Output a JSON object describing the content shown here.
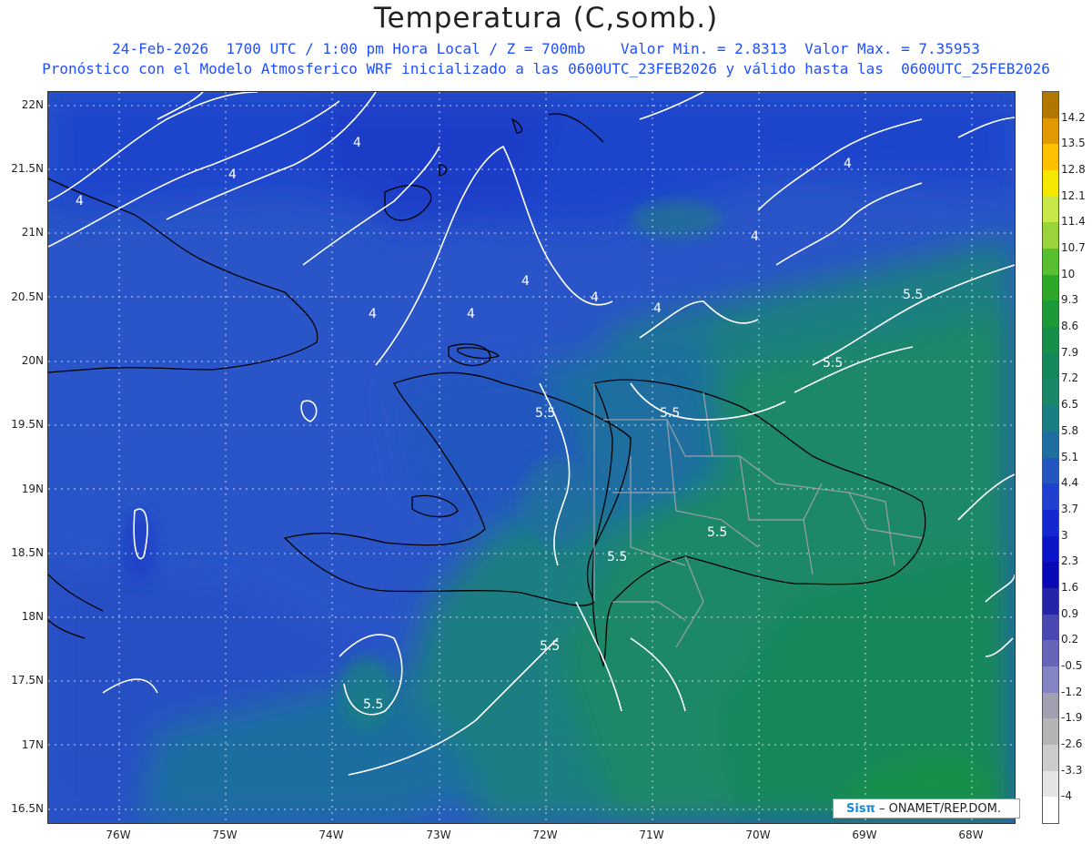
{
  "header": {
    "title": "Temperatura (C,somb.)",
    "line1": "24-Feb-2026  1700 UTC / 1:00 pm Hora Local / Z = 700mb    Valor Min. = 2.8313  Valor Max. = 7.35953",
    "line2": "Pronóstico con el Modelo Atmosferico WRF inicializado a las 0600UTC_23FEB2026 y válido hasta las  0600UTC_25FEB2026"
  },
  "axes": {
    "lat_labels": [
      "22N",
      "21.5N",
      "21N",
      "20.5N",
      "20N",
      "19.5N",
      "19N",
      "18.5N",
      "18N",
      "17.5N",
      "17N",
      "16.5N"
    ],
    "lon_labels": [
      "76W",
      "75W",
      "74W",
      "73W",
      "72W",
      "71W",
      "70W",
      "69W",
      "68W"
    ]
  },
  "colorbar": {
    "labels": [
      "14.2",
      "13.5",
      "12.8",
      "12.1",
      "11.4",
      "10.7",
      "10",
      "9.3",
      "8.6",
      "7.9",
      "7.2",
      "6.5",
      "5.8",
      "5.1",
      "4.4",
      "3.7",
      "3",
      "2.3",
      "1.6",
      "0.9",
      "0.2",
      "-0.5",
      "-1.2",
      "-1.9",
      "-2.6",
      "-3.3",
      "-4"
    ],
    "colors": [
      "#b07800",
      "#e09a00",
      "#ffc000",
      "#f5e800",
      "#c8e84a",
      "#9ad43a",
      "#58c030",
      "#2fa82a",
      "#1d9a38",
      "#15904a",
      "#13885a",
      "#1a8868",
      "#1a7e82",
      "#1f6ea0",
      "#2456c0",
      "#2040d0",
      "#1428d0",
      "#0c14c8",
      "#0808b4",
      "#2424a8",
      "#4848b0",
      "#6666b8",
      "#8484c4",
      "#a0a0b0",
      "#b4b4b4",
      "#cccccc",
      "#e4e4e4",
      "#ffffff"
    ]
  },
  "contour_labels": [
    "4",
    "4",
    "4",
    "4",
    "4",
    "4",
    "4",
    "4",
    "4",
    "4",
    "5.5",
    "5.5",
    "5.5",
    "5.5",
    "5.5",
    "5.5",
    "5.5",
    "5.5"
  ],
  "credit": {
    "logo": "Sisπ",
    "text": " – ONAMET/REP.DOM."
  }
}
